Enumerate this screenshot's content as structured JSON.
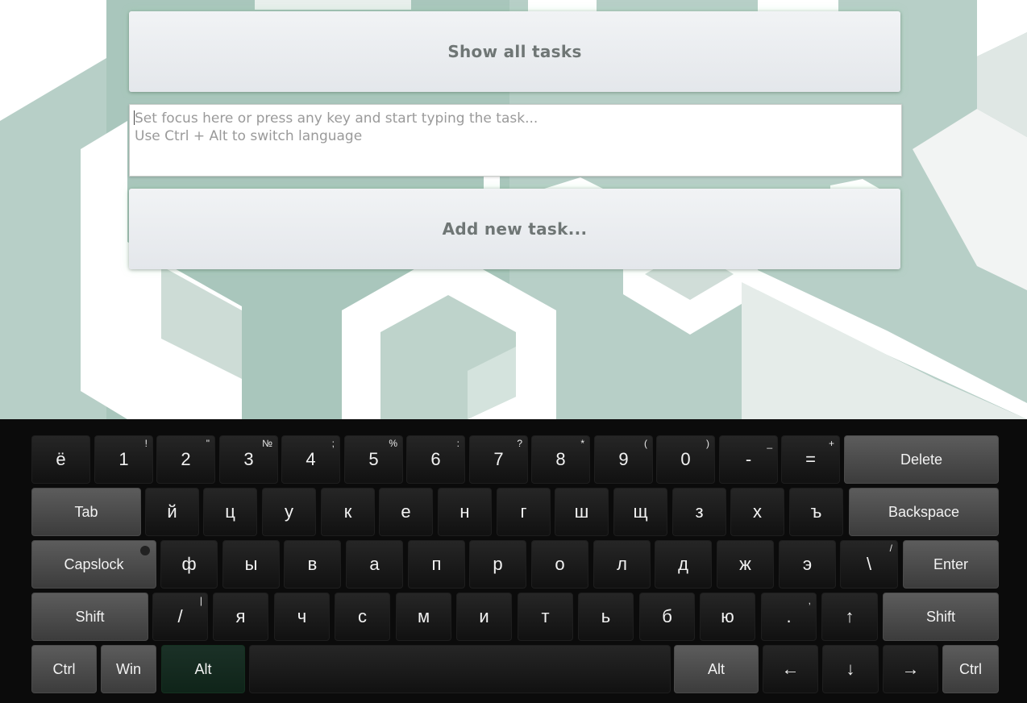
{
  "header": {
    "show_all_label": "Show all tasks",
    "add_task_label": "Add new task...",
    "task_input_placeholder": "Set focus here or press any key and start typing the task...\nUse Ctrl + Alt to switch language"
  },
  "colors": {
    "background_tint": "#b3cec5",
    "panel": "#e9ebee",
    "keyboard_bg": "#0b0b0b",
    "key_modifier": "#4b4b4b",
    "key_alt_active": "#15291e"
  },
  "keyboard": {
    "active_modifier": "Alt",
    "rows": [
      [
        {
          "label": "ё"
        },
        {
          "label": "1",
          "alt": "!"
        },
        {
          "label": "2",
          "alt": "\""
        },
        {
          "label": "3",
          "alt": "№"
        },
        {
          "label": "4",
          "alt": ";"
        },
        {
          "label": "5",
          "alt": "%"
        },
        {
          "label": "6",
          "alt": ":"
        },
        {
          "label": "7",
          "alt": "?"
        },
        {
          "label": "8",
          "alt": "*"
        },
        {
          "label": "9",
          "alt": "("
        },
        {
          "label": "0",
          "alt": ")"
        },
        {
          "label": "-",
          "alt": "_"
        },
        {
          "label": "=",
          "alt": "+"
        },
        {
          "label": "Delete",
          "mod": true
        }
      ],
      [
        {
          "label": "Tab",
          "mod": true
        },
        {
          "label": "й"
        },
        {
          "label": "ц"
        },
        {
          "label": "у"
        },
        {
          "label": "к"
        },
        {
          "label": "е"
        },
        {
          "label": "н"
        },
        {
          "label": "г"
        },
        {
          "label": "ш"
        },
        {
          "label": "щ"
        },
        {
          "label": "з"
        },
        {
          "label": "х"
        },
        {
          "label": "ъ"
        },
        {
          "label": "Backspace",
          "mod": true
        }
      ],
      [
        {
          "label": "Capslock",
          "mod": true,
          "indicator": true
        },
        {
          "label": "ф"
        },
        {
          "label": "ы"
        },
        {
          "label": "в"
        },
        {
          "label": "а"
        },
        {
          "label": "п"
        },
        {
          "label": "р"
        },
        {
          "label": "о"
        },
        {
          "label": "л"
        },
        {
          "label": "д"
        },
        {
          "label": "ж"
        },
        {
          "label": "э"
        },
        {
          "label": "\\",
          "alt": "/"
        },
        {
          "label": "Enter",
          "mod": true
        }
      ],
      [
        {
          "label": "Shift",
          "mod": true
        },
        {
          "label": "/",
          "alt": "|"
        },
        {
          "label": "я"
        },
        {
          "label": "ч"
        },
        {
          "label": "с"
        },
        {
          "label": "м"
        },
        {
          "label": "и"
        },
        {
          "label": "т"
        },
        {
          "label": "ь"
        },
        {
          "label": "б"
        },
        {
          "label": "ю"
        },
        {
          "label": ".",
          "alt": ","
        },
        {
          "label": "↑"
        },
        {
          "label": "Shift",
          "mod": true
        }
      ],
      [
        {
          "label": "Ctrl",
          "mod": true
        },
        {
          "label": "Win",
          "mod": true
        },
        {
          "label": "Alt",
          "mod": true,
          "active": true
        },
        {
          "label": ""
        },
        {
          "label": "Alt",
          "mod": true
        },
        {
          "label": "←"
        },
        {
          "label": "↓"
        },
        {
          "label": "→"
        },
        {
          "label": "Ctrl",
          "mod": true
        }
      ]
    ]
  }
}
